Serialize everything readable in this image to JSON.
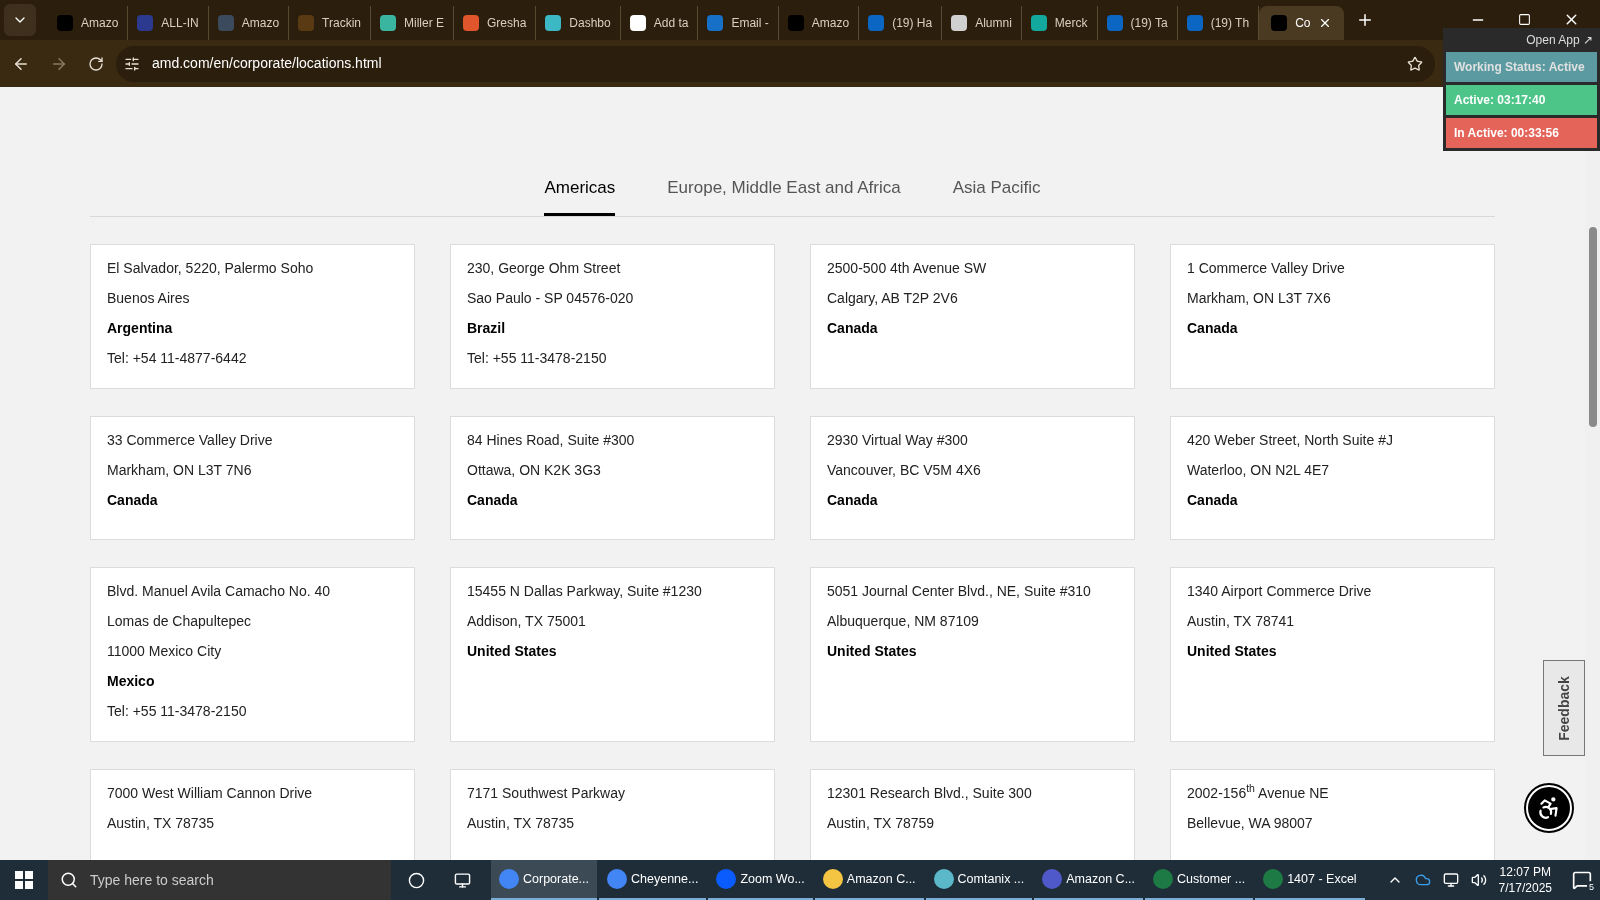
{
  "browser": {
    "tabs": [
      {
        "title": "Amazo",
        "color": "#000000",
        "selected": false
      },
      {
        "title": "ALL-IN",
        "color": "#2b3a8f",
        "selected": false
      },
      {
        "title": "Amazo",
        "color": "#3b4a5c",
        "selected": false
      },
      {
        "title": "Trackin",
        "color": "#5a3a12",
        "selected": false
      },
      {
        "title": "Miller E",
        "color": "#3ab5a0",
        "selected": false
      },
      {
        "title": "Gresha",
        "color": "#e0552b",
        "selected": false
      },
      {
        "title": "Dashbo",
        "color": "#3bb8c4",
        "selected": false
      },
      {
        "title": "Add ta",
        "color": "#ffffff",
        "selected": false
      },
      {
        "title": "Email -",
        "color": "#1670c8",
        "selected": false
      },
      {
        "title": "Amazo",
        "color": "#000000",
        "selected": false
      },
      {
        "title": "(19) Ha",
        "color": "#0a66c2",
        "selected": false
      },
      {
        "title": "Alumni",
        "color": "#d0d0d0",
        "selected": false
      },
      {
        "title": "Merck",
        "color": "#13a89e",
        "selected": false
      },
      {
        "title": "(19) Ta",
        "color": "#0a66c2",
        "selected": false
      },
      {
        "title": "(19) Th",
        "color": "#0a66c2",
        "selected": false
      },
      {
        "title": "Co",
        "color": "#000000",
        "selected": true
      }
    ],
    "url": "amd.com/en/corporate/locations.html"
  },
  "tracker": {
    "open_app": "Open App ↗",
    "status": "Working Status: Active",
    "active": "Active: 03:17:40",
    "inactive": "In Active: 00:33:56"
  },
  "region_tabs": [
    {
      "label": "Americas",
      "selected": true
    },
    {
      "label": "Europe, Middle East and Africa",
      "selected": false
    },
    {
      "label": "Asia Pacific",
      "selected": false
    }
  ],
  "locations": [
    {
      "lines": [
        {
          "kind": "address",
          "text": "El Salvador, 5220, Palermo Soho"
        },
        {
          "kind": "address",
          "text": "Buenos Aires"
        },
        {
          "kind": "country",
          "text": "Argentina"
        },
        {
          "kind": "address",
          "text": "Tel: +54 11-4877-6442"
        }
      ]
    },
    {
      "lines": [
        {
          "kind": "address",
          "text": "230, George Ohm Street"
        },
        {
          "kind": "address",
          "text": "Sao Paulo - SP 04576-020"
        },
        {
          "kind": "country",
          "text": "Brazil"
        },
        {
          "kind": "address",
          "text": "Tel: +55 11-3478-2150"
        }
      ]
    },
    {
      "lines": [
        {
          "kind": "address",
          "text": "2500-500 4th Avenue SW"
        },
        {
          "kind": "address",
          "text": "Calgary, AB T2P 2V6"
        },
        {
          "kind": "country",
          "text": "Canada"
        }
      ]
    },
    {
      "lines": [
        {
          "kind": "address",
          "text": "1 Commerce Valley Drive"
        },
        {
          "kind": "address",
          "text": "Markham, ON L3T 7X6"
        },
        {
          "kind": "country",
          "text": "Canada"
        }
      ]
    },
    {
      "lines": [
        {
          "kind": "address",
          "text": "33 Commerce Valley Drive"
        },
        {
          "kind": "address",
          "text": "Markham, ON  L3T 7N6"
        },
        {
          "kind": "country",
          "text": "Canada"
        }
      ]
    },
    {
      "lines": [
        {
          "kind": "address",
          "text": "84 Hines Road, Suite #300"
        },
        {
          "kind": "address",
          "text": "Ottawa, ON K2K 3G3"
        },
        {
          "kind": "country",
          "text": "Canada"
        }
      ]
    },
    {
      "lines": [
        {
          "kind": "address",
          "text": "2930 Virtual Way #300"
        },
        {
          "kind": "address",
          "text": "Vancouver, BC V5M 4X6"
        },
        {
          "kind": "country",
          "text": "Canada"
        }
      ]
    },
    {
      "lines": [
        {
          "kind": "address",
          "text": "420 Weber Street, North Suite #J"
        },
        {
          "kind": "address",
          "text": "Waterloo, ON N2L 4E7"
        },
        {
          "kind": "country",
          "text": "Canada"
        }
      ]
    },
    {
      "lines": [
        {
          "kind": "address",
          "text": "Blvd. Manuel Avila Camacho No. 40"
        },
        {
          "kind": "address",
          "text": "Lomas de Chapultepec"
        },
        {
          "kind": "address",
          "text": "11000 Mexico City"
        },
        {
          "kind": "country",
          "text": "Mexico"
        },
        {
          "kind": "address",
          "text": "Tel: +55 11-3478-2150"
        }
      ]
    },
    {
      "lines": [
        {
          "kind": "address",
          "text": "15455 N Dallas Parkway, Suite #1230"
        },
        {
          "kind": "address",
          "text": "Addison, TX 75001"
        },
        {
          "kind": "country",
          "text": "United States"
        }
      ]
    },
    {
      "lines": [
        {
          "kind": "address",
          "text": "5051 Journal Center Blvd., NE, Suite #310"
        },
        {
          "kind": "address",
          "text": "Albuquerque, NM 87109"
        },
        {
          "kind": "country",
          "text": "United States"
        }
      ]
    },
    {
      "lines": [
        {
          "kind": "address",
          "text": "1340 Airport Commerce Drive"
        },
        {
          "kind": "address",
          "text": "Austin, TX 78741"
        },
        {
          "kind": "country",
          "text": "United States"
        }
      ]
    },
    {
      "lines": [
        {
          "kind": "address",
          "text": "7000 West William Cannon Drive"
        },
        {
          "kind": "address",
          "text": "Austin, TX 78735"
        }
      ]
    },
    {
      "lines": [
        {
          "kind": "address",
          "text": "7171 Southwest Parkway"
        },
        {
          "kind": "address",
          "text": "Austin, TX 78735"
        }
      ]
    },
    {
      "lines": [
        {
          "kind": "address",
          "text": "12301 Research Blvd., Suite 300"
        },
        {
          "kind": "address",
          "text": "Austin, TX 78759"
        }
      ]
    },
    {
      "lines": [
        {
          "kind": "address",
          "text": "2002-156$^{th}$ Avenue NE"
        },
        {
          "kind": "address",
          "text": "Bellevue, WA 98007"
        }
      ]
    }
  ],
  "feedback": "Feedback",
  "taskbar": {
    "search_placeholder": "Type here to search",
    "apps": [
      {
        "label": "Corporate...",
        "color": "#4285f4",
        "selected": true
      },
      {
        "label": "Cheyenne...",
        "color": "#4285f4",
        "selected": false
      },
      {
        "label": "Zoom Wo...",
        "color": "#0b5cff",
        "selected": false
      },
      {
        "label": "Amazon C...",
        "color": "#f4c542",
        "selected": false
      },
      {
        "label": "Comtanix ...",
        "color": "#5bb8c9",
        "selected": false
      },
      {
        "label": "Amazon C...",
        "color": "#5059c9",
        "selected": false
      },
      {
        "label": "Customer ...",
        "color": "#1d7a45",
        "selected": false
      },
      {
        "label": "1407 - Excel",
        "color": "#1d7a45",
        "selected": false
      }
    ],
    "time": "12:07 PM",
    "date": "7/17/2025",
    "notifications": "5"
  }
}
